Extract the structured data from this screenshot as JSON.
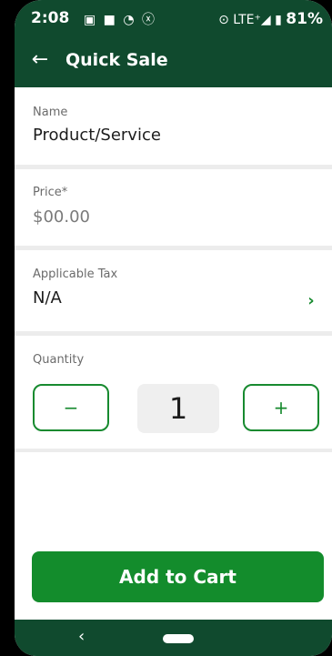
{
  "status_bar": {
    "time": "2:08",
    "left_icons": "▣ ■ ◔ ⓧ",
    "network": "⊙ LTE⁺◢ ▮",
    "battery": "81%"
  },
  "app_bar": {
    "back_icon": "←",
    "title": "Quick Sale"
  },
  "fields": {
    "name": {
      "label": "Name",
      "value": "Product/Service"
    },
    "price": {
      "label": "Price*",
      "value": "$00.00"
    },
    "tax": {
      "label": "Applicable Tax",
      "value": "N/A",
      "chevron": "›"
    }
  },
  "quantity": {
    "label": "Quantity",
    "minus": "−",
    "value": "1",
    "plus": "+"
  },
  "actions": {
    "add_to_cart": "Add to Cart"
  },
  "nav": {
    "back": "‹"
  },
  "colors": {
    "brand_dark": "#104a2e",
    "accent_green": "#178a2f",
    "button_green": "#138c2c"
  }
}
